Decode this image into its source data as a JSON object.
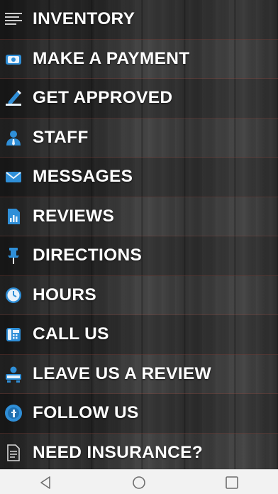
{
  "menu": {
    "items": [
      {
        "label": "INVENTORY",
        "icon": "list-lines-icon"
      },
      {
        "label": "MAKE A PAYMENT",
        "icon": "payment-card-icon"
      },
      {
        "label": "GET APPROVED",
        "icon": "pen-sign-icon"
      },
      {
        "label": "STAFF",
        "icon": "person-icon"
      },
      {
        "label": "MESSAGES",
        "icon": "envelope-icon"
      },
      {
        "label": "REVIEWS",
        "icon": "report-chart-icon"
      },
      {
        "label": "DIRECTIONS",
        "icon": "pushpin-icon"
      },
      {
        "label": "HOURS",
        "icon": "clock-icon"
      },
      {
        "label": "CALL US",
        "icon": "phone-icon"
      },
      {
        "label": "LEAVE US A REVIEW",
        "icon": "review-person-icon"
      },
      {
        "label": "FOLLOW US",
        "icon": "facebook-icon"
      },
      {
        "label": "NEED INSURANCE?",
        "icon": "document-icon"
      }
    ]
  },
  "navbar": {
    "buttons": [
      "back-icon",
      "home-icon",
      "recent-apps-icon"
    ]
  },
  "colors": {
    "icon_blue": "#2f8fd8",
    "icon_light": "#e8f2fb",
    "navbar_bg": "#f2f2f2",
    "navbar_icon": "#6e6e6e"
  }
}
